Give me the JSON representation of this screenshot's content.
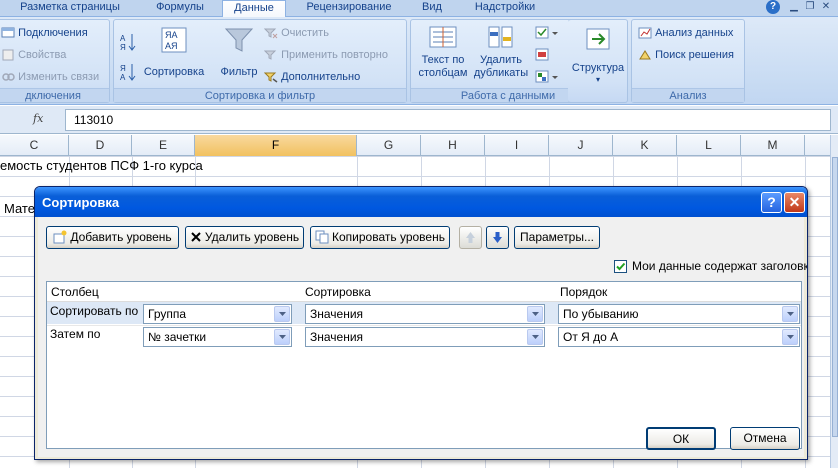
{
  "ribbon_tabs": [
    {
      "label": "Разметка страницы"
    },
    {
      "label": "Формулы"
    },
    {
      "label": "Данные"
    },
    {
      "label": "Рецензирование"
    },
    {
      "label": "Вид"
    },
    {
      "label": "Надстройки"
    }
  ],
  "ribbon": {
    "connections": {
      "connections_label": "Подключения",
      "properties_label": "Свойства",
      "edit_links_label": "Изменить связи",
      "group_label": "дключения"
    },
    "sort_filter": {
      "sort_label": "Сортировка",
      "filter_label": "Фильтр",
      "clear_label": "Очистить",
      "reapply_label": "Применить повторно",
      "advanced_label": "Дополнительно",
      "group_label": "Сортировка и фильтр"
    },
    "data_tools": {
      "text_to_columns_line1": "Текст по",
      "text_to_columns_line2": "столбцам",
      "remove_duplicates_line1": "Удалить",
      "remove_duplicates_line2": "дубликаты",
      "group_label": "Работа с данными"
    },
    "outline": {
      "label": "Структура"
    },
    "analysis": {
      "data_analysis_label": "Анализ данных",
      "solver_label": "Поиск решения",
      "group_label": "Анализ"
    }
  },
  "formula_bar": {
    "fx": "fx",
    "value": "113010"
  },
  "columns": [
    "C",
    "D",
    "E",
    "F",
    "G",
    "H",
    "I",
    "J",
    "K",
    "L",
    "M"
  ],
  "cells": {
    "title": "емость студентов ПСФ 1-го курса",
    "partial": "Мате"
  },
  "dialog": {
    "title": "Сортировка",
    "help": "?",
    "close": "✕",
    "add_level": "Добавить уровень",
    "delete_level": "Удалить уровень",
    "copy_level": "Копировать уровень",
    "options": "Параметры...",
    "has_headers_label": "Мои данные содержат заголовки",
    "has_headers_checked": true,
    "headers": {
      "column": "Столбец",
      "sort_on": "Сортировка",
      "order": "Порядок"
    },
    "rows": [
      {
        "label": "Сортировать по",
        "column": "Группа",
        "sort_on": "Значения",
        "order": "По убыванию"
      },
      {
        "label": "Затем по",
        "column": "№ зачетки",
        "sort_on": "Значения",
        "order": "От Я до А"
      }
    ],
    "ok": "ОК",
    "cancel": "Отмена"
  }
}
